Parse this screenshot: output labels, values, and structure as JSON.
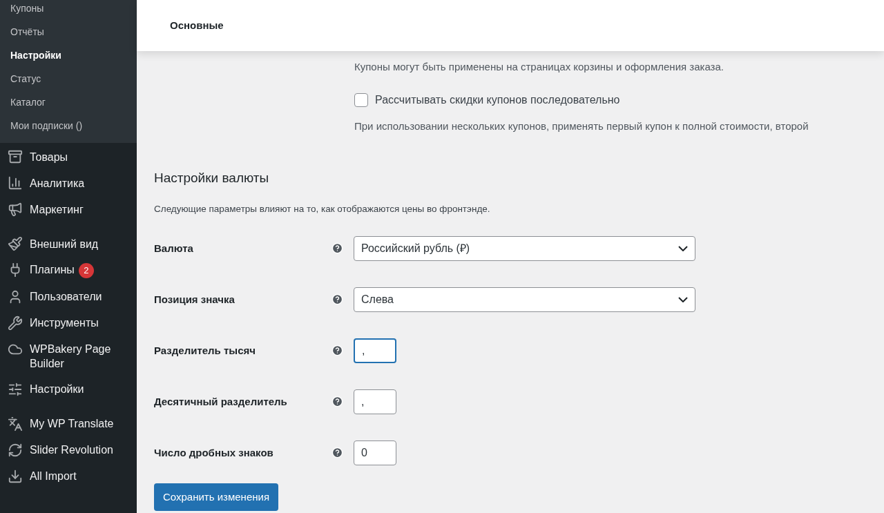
{
  "sidebar": {
    "submenu": [
      {
        "label": "Купоны",
        "selected": false
      },
      {
        "label": "Отчёты",
        "selected": false
      },
      {
        "label": "Настройки",
        "selected": true
      },
      {
        "label": "Статус",
        "selected": false
      },
      {
        "label": "Каталог",
        "selected": false
      },
      {
        "label": "Мои подписки ()",
        "selected": false
      }
    ],
    "menu_groups": [
      [
        {
          "kind": "box",
          "label": "Товары"
        },
        {
          "kind": "chart",
          "label": "Аналитика"
        },
        {
          "kind": "megaphone",
          "label": "Маркетинг"
        }
      ],
      [
        {
          "kind": "brush",
          "label": "Внешний вид"
        },
        {
          "kind": "plug",
          "label": "Плагины",
          "badge": "2"
        },
        {
          "kind": "user",
          "label": "Пользователи"
        },
        {
          "kind": "wrench",
          "label": "Инструменты"
        },
        {
          "kind": "cloud",
          "label": "WPBakery Page Builder"
        },
        {
          "kind": "sliders",
          "label": "Настройки"
        }
      ],
      [
        {
          "kind": "translate",
          "label": "My WP Translate"
        },
        {
          "kind": "refresh",
          "label": "Slider Revolution"
        },
        {
          "kind": "import",
          "label": "All Import"
        }
      ]
    ]
  },
  "header": {
    "tab": "Основные"
  },
  "coupons": {
    "description": "Купоны могут быть применены на страницах корзины и оформления заказа.",
    "checkbox": {
      "label": "Рассчитывать скидки купонов последовательно",
      "checked": false
    },
    "note": "При использовании нескольких купонов, применять первый купон к полной стоимости, второй"
  },
  "currency": {
    "title": "Настройки валюты",
    "description": "Следующие параметры влияют на то, как отображаются цены во фронтэнде.",
    "fields": [
      {
        "kind": "select",
        "label": "Валюта",
        "value": "Российский рубль (₽)",
        "focused": false
      },
      {
        "kind": "select",
        "label": "Позиция значка",
        "value": "Слева",
        "focused": false
      },
      {
        "kind": "text",
        "label": "Разделитель тысяч",
        "value": ",",
        "focused": true
      },
      {
        "kind": "text",
        "label": "Десятичный разделитель",
        "value": ",",
        "focused": false
      },
      {
        "kind": "text",
        "label": "Число дробных знаков",
        "value": "0",
        "focused": false
      }
    ]
  },
  "save_button": "Сохранить изменения"
}
